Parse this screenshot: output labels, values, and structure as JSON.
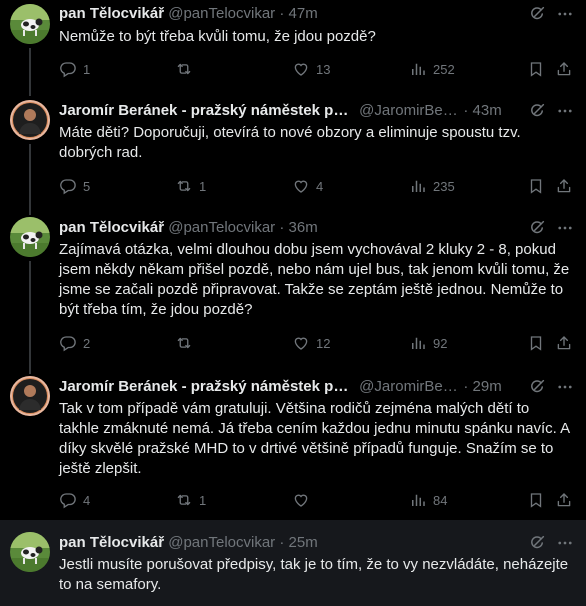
{
  "colors": {
    "background": "#000000",
    "text": "#e7e9ea",
    "muted": "#71767b",
    "highlight_bg": "#16181c",
    "thread_line": "#333639"
  },
  "tweets": [
    {
      "name": "pan Tělocvikář",
      "handle": "@panTelocvikar",
      "time": "· 47m",
      "text": "Nemůže to být třeba kvůli tomu, že jdou pozdě?",
      "replies": "1",
      "retweets": "",
      "likes": "13",
      "views": "252"
    },
    {
      "name": "Jaromír Beránek - pražský náměstek pro ...",
      "handle": "@JaromirBer...",
      "time": "· 43m",
      "text": "Máte děti? Doporučuji, otevírá to nové obzory a eliminuje spoustu tzv. dobrých rad.",
      "replies": "5",
      "retweets": "1",
      "likes": "4",
      "views": "235"
    },
    {
      "name": "pan Tělocvikář",
      "handle": "@panTelocvikar",
      "time": "· 36m",
      "text": "Zajímavá otázka, velmi dlouhou dobu jsem vychovával 2 kluky 2 - 8, pokud jsem někdy někam přišel pozdě, nebo nám ujel bus, tak jenom kvůli tomu, že jsme se začali pozdě připravovat. Takže se zeptám ještě jednou. Nemůže to být třeba tím, že jdou pozdě?",
      "replies": "2",
      "retweets": "",
      "likes": "12",
      "views": "92"
    },
    {
      "name": "Jaromír Beránek - pražský náměstek pro ...",
      "handle": "@JaromirBer...",
      "time": "· 29m",
      "text": "Tak v tom případě vám gratuluji. Většina rodičů zejména malých dětí to takhle zmáknuté nemá. Já třeba cením každou jednu minutu spánku navíc. A díky skvělé pražské MHD to v drtivé většině případů funguje. Snažím se to ještě zlepšit.",
      "replies": "4",
      "retweets": "1",
      "likes": "",
      "views": "84"
    },
    {
      "name": "pan Tělocvikář",
      "handle": "@panTelocvikar",
      "time": "· 25m",
      "text": "Jestli musíte porušovat předpisy, tak je to tím, že to vy nezvládáte, neházejte to na semafory."
    }
  ]
}
